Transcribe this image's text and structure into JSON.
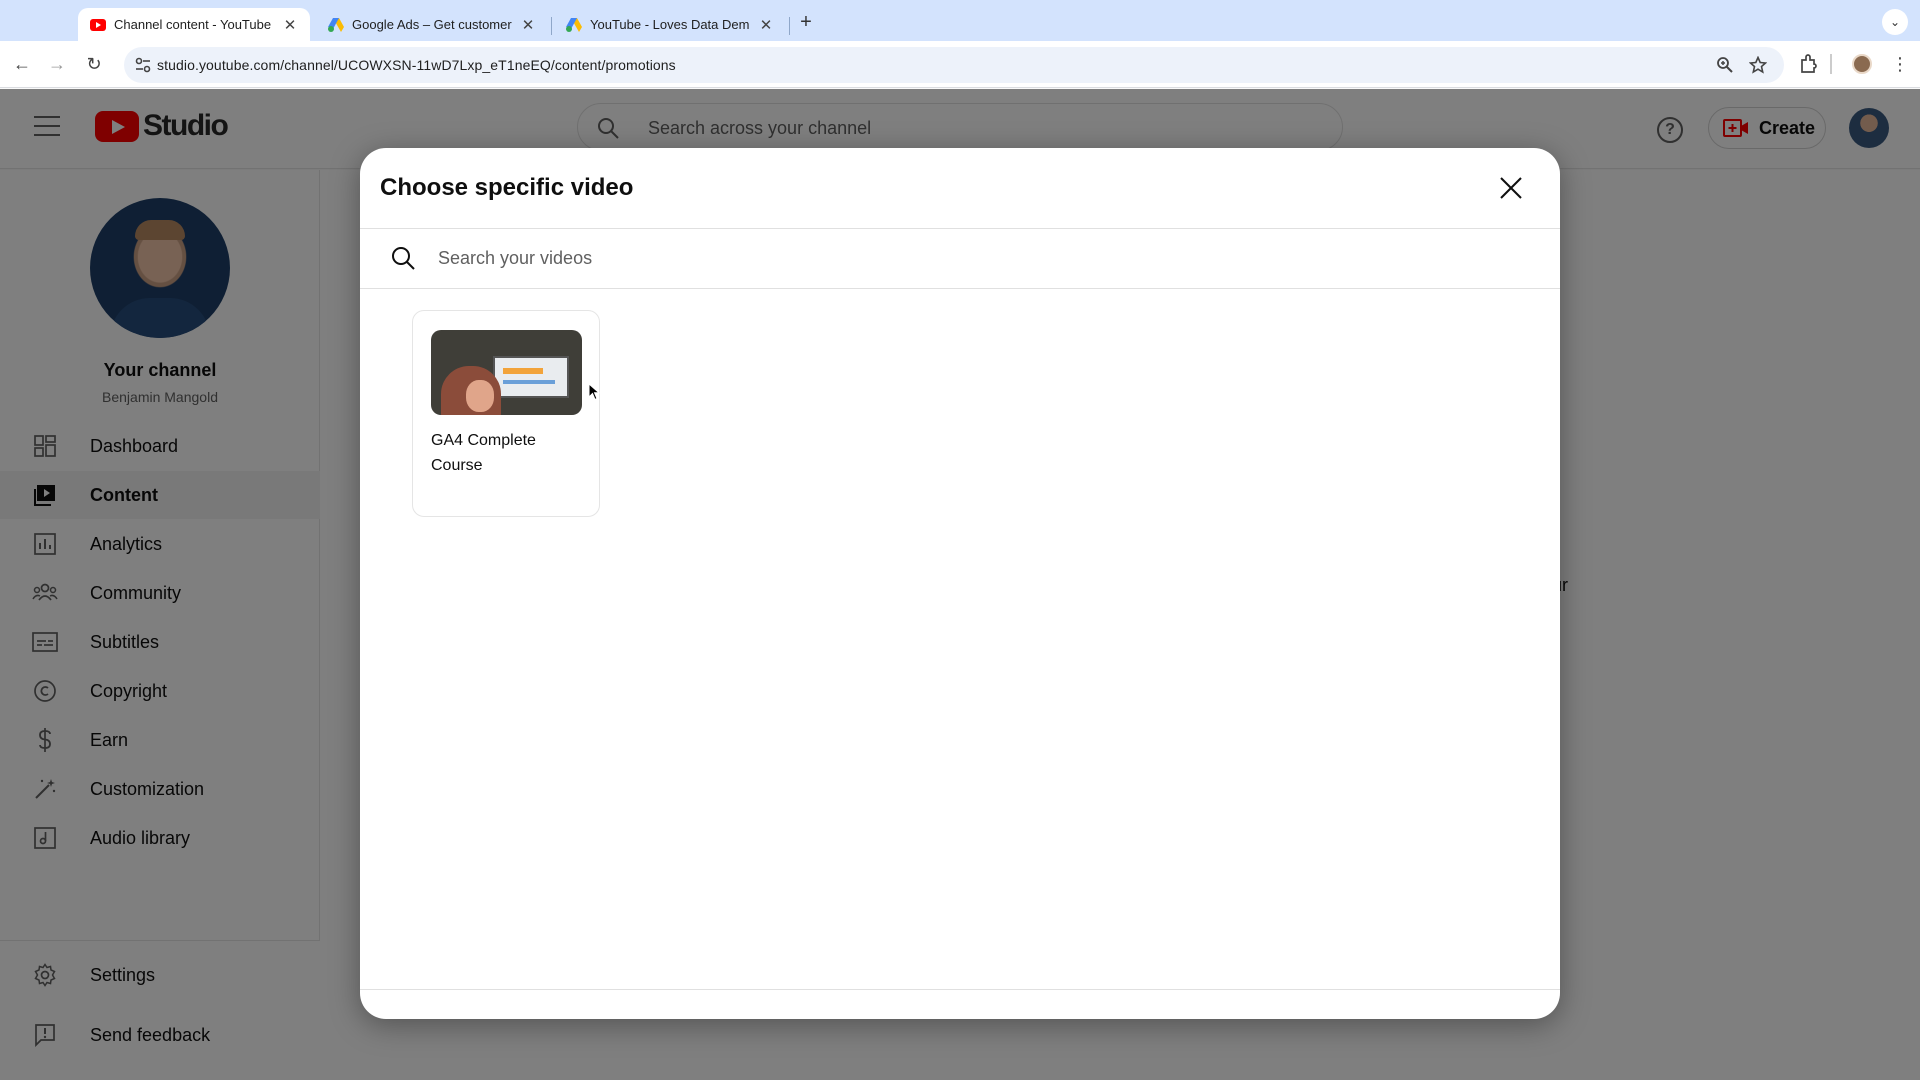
{
  "browser": {
    "tabs": [
      {
        "title": "Channel content - YouTube Studio",
        "active": true
      },
      {
        "title": "Google Ads – Get customers",
        "active": false
      },
      {
        "title": "YouTube - Loves Data Demo",
        "active": false
      }
    ],
    "url": "studio.youtube.com/channel/UCOWXSN-11wD7Lxp_eT1neEQ/content/promotions"
  },
  "studio": {
    "logo_text": "Studio",
    "search_placeholder": "Search across your channel",
    "create_label": "Create"
  },
  "sidebar": {
    "channel_title": "Your channel",
    "channel_name": "Benjamin Mangold",
    "items": [
      {
        "label": "Dashboard",
        "icon": "dashboard-icon"
      },
      {
        "label": "Content",
        "icon": "content-icon",
        "active": true
      },
      {
        "label": "Analytics",
        "icon": "analytics-icon"
      },
      {
        "label": "Community",
        "icon": "community-icon"
      },
      {
        "label": "Subtitles",
        "icon": "subtitles-icon"
      },
      {
        "label": "Copyright",
        "icon": "copyright-icon"
      },
      {
        "label": "Earn",
        "icon": "earn-icon"
      },
      {
        "label": "Customization",
        "icon": "customization-icon"
      },
      {
        "label": "Audio library",
        "icon": "audio-library-icon"
      }
    ],
    "bottom_items": [
      {
        "label": "Settings",
        "icon": "gear-icon"
      },
      {
        "label": "Send feedback",
        "icon": "feedback-icon"
      }
    ]
  },
  "background": {
    "peek_text": "ur"
  },
  "dialog": {
    "title": "Choose specific video",
    "search_placeholder": "Search your videos",
    "videos": [
      {
        "title": "GA4 Complete Course"
      }
    ]
  }
}
